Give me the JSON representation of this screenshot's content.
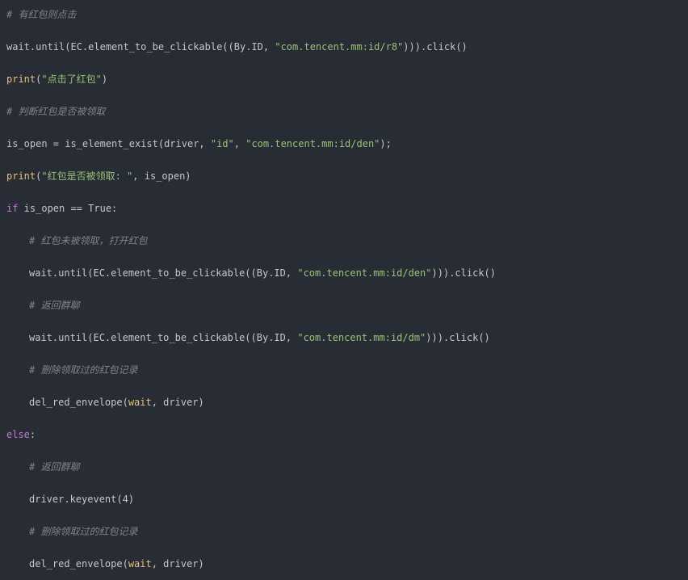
{
  "lines": [
    {
      "comment": "# 有红包则点击"
    },
    {
      "pre": "wait.until(EC.element_to_be_clickable((By.ID, ",
      "str": "\"com.tencent.mm:id/r8\"",
      "post": "))).click()"
    },
    {
      "fn": "print",
      "open": "(",
      "str": "\"点击了红包\"",
      "close": ")"
    },
    {
      "comment": "# 判断红包是否被领取"
    },
    {
      "pre": "is_open = is_element_exist(driver, ",
      "str1": "\"id\"",
      "mid": ", ",
      "str2": "\"com.tencent.mm:id/den\"",
      "post": ");"
    },
    {
      "fn": "print",
      "open": "(",
      "str": "\"红包是否被领取: \"",
      "close": ", is_open)"
    },
    {
      "kw": "if",
      "post": " is_open == True:"
    },
    {
      "comment": "# 红包未被领取，打开红包"
    },
    {
      "pre": "wait.until(EC.element_to_be_clickable((By.ID, ",
      "str": "\"com.tencent.mm:id/den\"",
      "post": "))).click()"
    },
    {
      "comment": "# 返回群聊"
    },
    {
      "pre": "wait.until(EC.element_to_be_clickable((By.ID, ",
      "str": "\"com.tencent.mm:id/dm\"",
      "post": "))).click()"
    },
    {
      "comment": "# 删除领取过的红包记录"
    },
    {
      "pre": "del_red_envelope(",
      "arg": "wait",
      "post": ", driver)"
    },
    {
      "kw": "else",
      "post": ":"
    },
    {
      "comment": "# 返回群聊"
    },
    {
      "pre": "driver.keyevent(4)"
    },
    {
      "comment": "# 删除领取过的红包记录"
    },
    {
      "pre": "del_red_envelope(",
      "arg": "wait",
      "post": ", driver)"
    }
  ],
  "colors": {
    "background": "#282c34",
    "comment": "#7f848e",
    "string": "#98c379",
    "function": "#e5c07b",
    "keyword": "#c678dd",
    "text": "#c5c8c6"
  }
}
